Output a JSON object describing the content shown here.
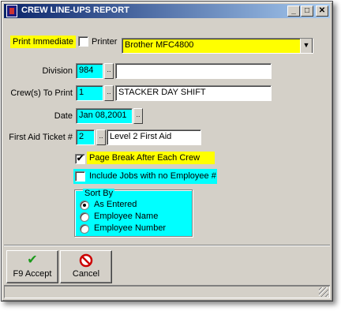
{
  "window": {
    "title": "CREW LINE-UPS REPORT",
    "minimize": "_",
    "maximize": "□",
    "close": "✕"
  },
  "print_immediate": {
    "label": "Print Immediate",
    "checked": false
  },
  "printer": {
    "label": "Printer",
    "value": "Brother MFC4800"
  },
  "division": {
    "label": "Division",
    "code": "984",
    "name": ""
  },
  "crews": {
    "label": "Crew(s) To Print",
    "code": "1",
    "name": "STACKER DAY SHIFT"
  },
  "date": {
    "label": "Date",
    "value": "Jan 08,2001"
  },
  "first_aid": {
    "label": "First Aid Ticket #",
    "code": "2",
    "name": "Level 2 First Aid"
  },
  "page_break": {
    "label": "Page Break After Each Crew",
    "checked": true
  },
  "include_jobs": {
    "label": "Include Jobs with no Employee #",
    "checked": false
  },
  "sort_by": {
    "title": "Sort By",
    "options": [
      "As Entered",
      "Employee Name",
      "Employee Number"
    ],
    "selected": "As Entered"
  },
  "buttons": {
    "accept": "F9 Accept",
    "cancel": "Cancel"
  },
  "dots_label": "..",
  "check_mark": "✔",
  "colors": {
    "title_start": "#0a246a",
    "title_end": "#a6caf0",
    "highlight_yellow": "#ffff00",
    "highlight_cyan": "#00ffff",
    "accept_icon": "#1a9a1a",
    "cancel_icon": "#cc0000"
  }
}
